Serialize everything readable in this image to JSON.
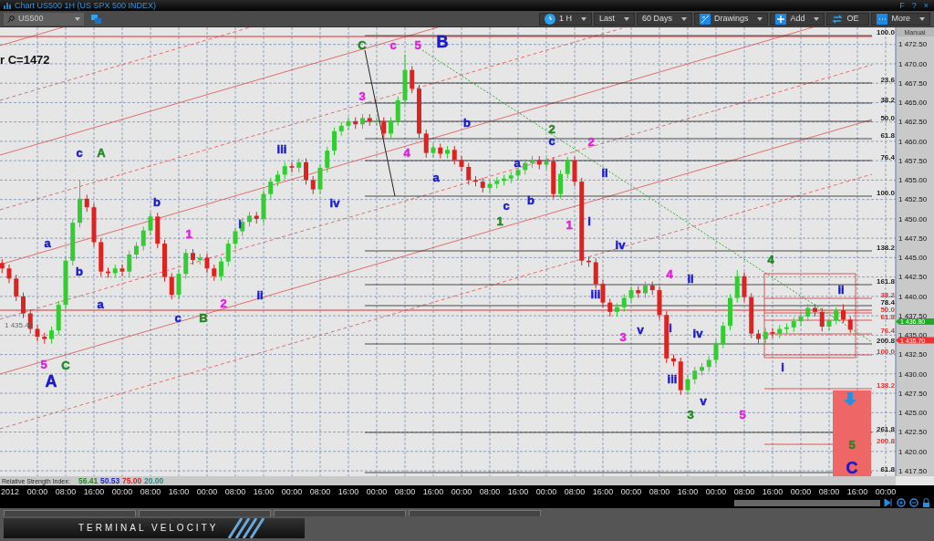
{
  "window": {
    "title": "Chart US500 1H (US SPX 500 INDEX)",
    "controls": [
      "F",
      "?",
      "×"
    ]
  },
  "toolbar": {
    "symbol": "US500",
    "buttons": [
      {
        "label": "1 H",
        "dropdown": true
      },
      {
        "label": "Last",
        "dropdown": true
      },
      {
        "label": "60 Days",
        "dropdown": true
      },
      {
        "label": "Drawings",
        "dropdown": true
      },
      {
        "label": "Add",
        "dropdown": true
      },
      {
        "label": "OE",
        "dropdown": false
      },
      {
        "label": "More",
        "dropdown": true
      }
    ]
  },
  "chart": {
    "annotation": "r C=1472",
    "prior_close": "1 435.40",
    "year_label": "2012",
    "chart_data": {
      "type": "candlestick",
      "ylim": [
        1416.8,
        1474.7
      ],
      "categories": [
        null,
        null,
        null,
        null,
        null,
        "00:00",
        null,
        null,
        null,
        "08:00",
        null,
        null,
        null,
        "16:00",
        null,
        null,
        null,
        "00:00",
        null,
        null,
        null,
        "08:00",
        null,
        null,
        null,
        "16:00",
        null,
        null,
        null,
        "00:00",
        null,
        null,
        null,
        "08:00",
        null,
        null,
        null,
        "16:00",
        null,
        null,
        null,
        "00:00",
        null,
        null,
        null,
        "08:00",
        null,
        null,
        null,
        "16:00",
        null,
        null,
        null,
        "00:00",
        null,
        null,
        null,
        "08:00",
        null,
        null,
        null,
        "16:00",
        null,
        null,
        null,
        "00:00",
        null,
        null,
        null,
        "08:00",
        null,
        null,
        null,
        "16:00",
        null,
        null,
        null,
        "00:00",
        null,
        null,
        null,
        "08:00",
        null,
        null,
        null,
        "16:00",
        null,
        null,
        null,
        "00:00",
        null,
        null,
        null,
        "08:00",
        null,
        null,
        null,
        "16:00",
        null,
        null,
        null,
        "00:00",
        null,
        null,
        null,
        "08:00",
        null,
        null,
        null,
        "16:00",
        null,
        null,
        null,
        "00:00",
        null,
        null,
        null,
        "08:00",
        null,
        null,
        null,
        "16:00",
        null,
        null,
        null,
        "00:00"
      ],
      "yticks": [
        {
          "value": 1472.5,
          "label": "1 472.50"
        },
        {
          "value": 1470,
          "label": "1 470.00"
        },
        {
          "value": 1467.5,
          "label": "1 467.50"
        },
        {
          "value": 1465,
          "label": "1 465.00"
        },
        {
          "value": 1462.5,
          "label": "1 462.50"
        },
        {
          "value": 1460,
          "label": "1 460.00"
        },
        {
          "value": 1457.5,
          "label": "1 457.50"
        },
        {
          "value": 1455,
          "label": "1 455.00"
        },
        {
          "value": 1452.5,
          "label": "1 452.50"
        },
        {
          "value": 1450,
          "label": "1 450.00"
        },
        {
          "value": 1447.5,
          "label": "1 447.50"
        },
        {
          "value": 1445,
          "label": "1 445.00"
        },
        {
          "value": 1442.5,
          "label": "1 442.50"
        },
        {
          "value": 1440,
          "label": "1 440.00"
        },
        {
          "value": 1437.5,
          "label": "1 437.50"
        },
        {
          "value": 1435,
          "label": "1 435.00"
        },
        {
          "value": 1432.5,
          "label": "1 432.50"
        },
        {
          "value": 1430,
          "label": "1 430.00"
        },
        {
          "value": 1427.5,
          "label": "1 427.50"
        },
        {
          "value": 1425,
          "label": "1 425.00"
        },
        {
          "value": 1422.5,
          "label": "1 422.50"
        },
        {
          "value": 1420,
          "label": "1 420.00"
        },
        {
          "value": 1417.5,
          "label": "1 417.50"
        }
      ],
      "ohlc": [
        [
          1444.3,
          1444.8,
          1443.0,
          1443.6
        ],
        [
          1443.6,
          1444.1,
          1441.7,
          1442.3
        ],
        [
          1442.3,
          1442.8,
          1439.4,
          1440.0
        ],
        [
          1440.0,
          1440.5,
          1437.2,
          1437.8
        ],
        [
          1437.8,
          1438.3,
          1435.2,
          1435.8
        ],
        [
          1435.8,
          1436.3,
          1434.2,
          1434.8
        ],
        [
          1434.8,
          1435.3,
          1433.9,
          1434.5
        ],
        [
          1434.5,
          1436.1,
          1433.9,
          1435.6
        ],
        [
          1435.6,
          1439.4,
          1435.0,
          1438.9
        ],
        [
          1438.9,
          1445.1,
          1438.3,
          1444.6
        ],
        [
          1444.6,
          1450.0,
          1444.0,
          1449.5
        ],
        [
          1449.5,
          1455.0,
          1448.9,
          1452.6
        ],
        [
          1452.6,
          1453.1,
          1450.9,
          1451.5
        ],
        [
          1451.5,
          1452.0,
          1446.4,
          1447.0
        ],
        [
          1447.0,
          1447.5,
          1442.6,
          1443.2
        ],
        [
          1443.2,
          1443.7,
          1442.4,
          1443.0
        ],
        [
          1443.0,
          1444.1,
          1442.4,
          1443.6
        ],
        [
          1443.6,
          1444.1,
          1442.6,
          1443.2
        ],
        [
          1443.2,
          1445.9,
          1442.6,
          1445.4
        ],
        [
          1445.4,
          1447.0,
          1444.8,
          1446.5
        ],
        [
          1446.5,
          1449.0,
          1445.9,
          1448.5
        ],
        [
          1448.5,
          1450.8,
          1447.9,
          1450.3
        ],
        [
          1450.3,
          1450.8,
          1446.2,
          1446.8
        ],
        [
          1446.8,
          1447.3,
          1441.9,
          1442.5
        ],
        [
          1442.5,
          1443.0,
          1439.6,
          1440.2
        ],
        [
          1440.2,
          1443.4,
          1439.6,
          1442.9
        ],
        [
          1442.9,
          1446.1,
          1442.3,
          1445.6
        ],
        [
          1445.6,
          1446.1,
          1444.1,
          1444.7
        ],
        [
          1444.7,
          1445.5,
          1444.1,
          1445.0
        ],
        [
          1445.0,
          1445.5,
          1443.0,
          1443.6
        ],
        [
          1443.6,
          1444.1,
          1442.0,
          1442.6
        ],
        [
          1442.6,
          1445.0,
          1442.0,
          1444.5
        ],
        [
          1444.5,
          1447.3,
          1443.9,
          1446.8
        ],
        [
          1446.8,
          1448.9,
          1446.2,
          1448.4
        ],
        [
          1448.4,
          1450.1,
          1447.8,
          1449.6
        ],
        [
          1449.6,
          1450.9,
          1449.0,
          1450.4
        ],
        [
          1450.4,
          1450.9,
          1449.4,
          1450.0
        ],
        [
          1450.0,
          1453.7,
          1449.4,
          1453.2
        ],
        [
          1453.2,
          1455.3,
          1452.6,
          1454.8
        ],
        [
          1454.8,
          1456.2,
          1454.2,
          1455.7
        ],
        [
          1455.7,
          1457.3,
          1455.1,
          1456.8
        ],
        [
          1456.8,
          1457.3,
          1456.0,
          1456.6
        ],
        [
          1456.6,
          1457.8,
          1456.0,
          1457.3
        ],
        [
          1457.3,
          1457.8,
          1454.4,
          1455.0
        ],
        [
          1455.0,
          1455.5,
          1453.2,
          1453.8
        ],
        [
          1453.8,
          1457.1,
          1453.2,
          1456.6
        ],
        [
          1456.6,
          1459.3,
          1456.0,
          1458.8
        ],
        [
          1458.8,
          1461.8,
          1458.2,
          1461.3
        ],
        [
          1461.3,
          1462.5,
          1460.7,
          1462.0
        ],
        [
          1462.0,
          1463.1,
          1461.4,
          1462.6
        ],
        [
          1462.6,
          1463.1,
          1461.6,
          1462.2
        ],
        [
          1462.2,
          1463.5,
          1461.6,
          1463.0
        ],
        [
          1463.0,
          1463.5,
          1462.0,
          1462.6
        ],
        [
          1462.6,
          1463.1,
          1462.0,
          1462.6
        ],
        [
          1462.6,
          1463.1,
          1460.4,
          1461.0
        ],
        [
          1461.0,
          1463.1,
          1460.4,
          1462.6
        ],
        [
          1462.6,
          1465.8,
          1462.0,
          1465.3
        ],
        [
          1465.3,
          1471.2,
          1464.7,
          1469.2
        ],
        [
          1469.2,
          1469.7,
          1466.2,
          1466.8
        ],
        [
          1466.8,
          1467.3,
          1460.4,
          1461.0
        ],
        [
          1461.0,
          1461.5,
          1457.9,
          1458.5
        ],
        [
          1458.5,
          1459.7,
          1457.9,
          1459.2
        ],
        [
          1459.2,
          1459.7,
          1457.8,
          1458.4
        ],
        [
          1458.4,
          1459.4,
          1457.8,
          1458.9
        ],
        [
          1458.9,
          1459.4,
          1457.0,
          1457.6
        ],
        [
          1457.6,
          1458.1,
          1456.1,
          1456.7
        ],
        [
          1456.7,
          1457.2,
          1454.4,
          1455.0
        ],
        [
          1455.0,
          1455.5,
          1454.2,
          1454.8
        ],
        [
          1454.8,
          1455.3,
          1453.4,
          1454.0
        ],
        [
          1454.0,
          1455.0,
          1453.4,
          1454.5
        ],
        [
          1454.5,
          1455.4,
          1453.9,
          1454.9
        ],
        [
          1454.9,
          1455.7,
          1454.3,
          1455.2
        ],
        [
          1455.2,
          1456.1,
          1454.6,
          1455.6
        ],
        [
          1455.6,
          1456.8,
          1455.0,
          1456.3
        ],
        [
          1456.3,
          1457.7,
          1455.7,
          1457.2
        ],
        [
          1457.2,
          1458.1,
          1456.6,
          1457.6
        ],
        [
          1457.6,
          1458.1,
          1456.4,
          1457.0
        ],
        [
          1457.0,
          1457.9,
          1456.4,
          1457.4
        ],
        [
          1457.4,
          1457.9,
          1452.6,
          1453.2
        ],
        [
          1453.2,
          1456.3,
          1452.6,
          1455.8
        ],
        [
          1455.8,
          1458.0,
          1455.2,
          1457.5
        ],
        [
          1457.5,
          1458.0,
          1454.2,
          1454.8
        ],
        [
          1454.8,
          1455.3,
          1444.0,
          1444.6
        ],
        [
          1444.6,
          1445.1,
          1443.8,
          1444.4
        ],
        [
          1444.4,
          1444.9,
          1441.0,
          1441.6
        ],
        [
          1441.6,
          1442.1,
          1438.6,
          1439.2
        ],
        [
          1439.2,
          1439.7,
          1437.4,
          1438.0
        ],
        [
          1438.0,
          1439.1,
          1437.4,
          1438.6
        ],
        [
          1438.6,
          1440.3,
          1438.0,
          1439.8
        ],
        [
          1439.8,
          1441.3,
          1439.2,
          1440.8
        ],
        [
          1440.8,
          1441.3,
          1439.8,
          1440.4
        ],
        [
          1440.4,
          1441.9,
          1439.8,
          1441.4
        ],
        [
          1441.4,
          1441.9,
          1440.2,
          1440.8
        ],
        [
          1440.8,
          1441.3,
          1437.0,
          1437.6
        ],
        [
          1437.6,
          1438.1,
          1431.4,
          1432.0
        ],
        [
          1432.0,
          1432.5,
          1431.0,
          1431.6
        ],
        [
          1431.6,
          1432.1,
          1427.3,
          1427.9
        ],
        [
          1427.9,
          1429.8,
          1427.3,
          1429.3
        ],
        [
          1429.3,
          1430.9,
          1428.7,
          1430.4
        ],
        [
          1430.4,
          1431.4,
          1429.8,
          1430.9
        ],
        [
          1430.9,
          1432.3,
          1430.3,
          1431.8
        ],
        [
          1431.8,
          1434.4,
          1431.2,
          1433.9
        ],
        [
          1433.9,
          1436.7,
          1433.3,
          1436.2
        ],
        [
          1436.2,
          1440.3,
          1435.6,
          1439.8
        ],
        [
          1439.8,
          1443.4,
          1439.2,
          1442.6
        ],
        [
          1442.6,
          1443.1,
          1439.3,
          1439.9
        ],
        [
          1439.9,
          1440.4,
          1434.6,
          1435.2
        ],
        [
          1435.2,
          1435.7,
          1433.9,
          1434.5
        ],
        [
          1434.5,
          1435.9,
          1433.9,
          1435.4
        ],
        [
          1435.4,
          1435.9,
          1434.6,
          1435.2
        ],
        [
          1435.2,
          1436.3,
          1434.6,
          1435.8
        ],
        [
          1435.8,
          1436.5,
          1435.2,
          1436.0
        ],
        [
          1436.0,
          1437.3,
          1435.4,
          1436.8
        ],
        [
          1436.8,
          1437.9,
          1436.2,
          1437.4
        ],
        [
          1437.4,
          1439.0,
          1436.8,
          1438.5
        ],
        [
          1438.5,
          1439.0,
          1437.4,
          1438.0
        ],
        [
          1438.0,
          1438.5,
          1435.5,
          1436.1
        ],
        [
          1436.1,
          1437.2,
          1435.6,
          1436.9
        ],
        [
          1436.9,
          1438.6,
          1436.4,
          1438.2
        ],
        [
          1438.2,
          1439.0,
          1436.6,
          1437.0
        ],
        [
          1437.0,
          1437.4,
          1435.3,
          1435.7
        ],
        null,
        null,
        null,
        null,
        null
      ]
    },
    "wave_labels": [
      {
        "text": "c",
        "color": "#1a1acc",
        "kind": "minor"
      },
      {
        "text": "A",
        "color": "#228822",
        "kind": "minor"
      },
      {
        "text": "a",
        "color": "#1a1acc",
        "kind": "minor"
      },
      {
        "text": "b",
        "color": "#1a1acc",
        "kind": "minor"
      },
      {
        "text": "a",
        "color": "#1a1acc",
        "kind": "minor"
      },
      {
        "text": "5",
        "color": "#dd22dd",
        "kind": "minor"
      },
      {
        "text": "C",
        "color": "#228822",
        "kind": "minor"
      },
      {
        "text": "A",
        "color": "#1a1acc",
        "kind": "major"
      },
      {
        "text": "b",
        "color": "#1a1acc",
        "kind": "minor"
      },
      {
        "text": "c",
        "color": "#1a1acc",
        "kind": "minor"
      },
      {
        "text": "1",
        "color": "#dd22dd",
        "kind": "minor"
      },
      {
        "text": "B",
        "color": "#228822",
        "kind": "minor"
      },
      {
        "text": "2",
        "color": "#dd22dd",
        "kind": "minor"
      },
      {
        "text": "i",
        "color": "#1a1acc",
        "kind": "minor"
      },
      {
        "text": "ii",
        "color": "#1a1acc",
        "kind": "minor"
      },
      {
        "text": "iii",
        "color": "#1a1acc",
        "kind": "minor"
      },
      {
        "text": "iv",
        "color": "#1a1acc",
        "kind": "minor"
      },
      {
        "text": "C",
        "color": "#228822",
        "kind": "minor"
      },
      {
        "text": "c",
        "color": "#dd22dd",
        "kind": "minor"
      },
      {
        "text": "5",
        "color": "#dd22dd",
        "kind": "minor"
      },
      {
        "text": "B",
        "color": "#1a1acc",
        "kind": "major"
      },
      {
        "text": "3",
        "color": "#dd22dd",
        "kind": "minor"
      },
      {
        "text": "4",
        "color": "#dd22dd",
        "kind": "minor"
      },
      {
        "text": "a",
        "color": "#1a1acc",
        "kind": "minor"
      },
      {
        "text": "b",
        "color": "#1a1acc",
        "kind": "minor"
      },
      {
        "text": "2",
        "color": "#228822",
        "kind": "minor"
      },
      {
        "text": "c",
        "color": "#1a1acc",
        "kind": "minor"
      },
      {
        "text": "2",
        "color": "#dd22dd",
        "kind": "minor"
      },
      {
        "text": "ii",
        "color": "#1a1acc",
        "kind": "minor"
      },
      {
        "text": "a",
        "color": "#1a1acc",
        "kind": "minor"
      },
      {
        "text": "c",
        "color": "#1a1acc",
        "kind": "minor"
      },
      {
        "text": "b",
        "color": "#1a1acc",
        "kind": "minor"
      },
      {
        "text": "1",
        "color": "#228822",
        "kind": "minor"
      },
      {
        "text": "1",
        "color": "#dd22dd",
        "kind": "minor"
      },
      {
        "text": "i",
        "color": "#1a1acc",
        "kind": "minor"
      },
      {
        "text": "iv",
        "color": "#1a1acc",
        "kind": "minor"
      },
      {
        "text": "iii",
        "color": "#1a1acc",
        "kind": "minor"
      },
      {
        "text": "3",
        "color": "#dd22dd",
        "kind": "minor"
      },
      {
        "text": "v",
        "color": "#1a1acc",
        "kind": "minor"
      },
      {
        "text": "4",
        "color": "#dd22dd",
        "kind": "minor"
      },
      {
        "text": "ii",
        "color": "#1a1acc",
        "kind": "minor"
      },
      {
        "text": "i",
        "color": "#1a1acc",
        "kind": "minor"
      },
      {
        "text": "iv",
        "color": "#1a1acc",
        "kind": "minor"
      },
      {
        "text": "iii",
        "color": "#1a1acc",
        "kind": "minor"
      },
      {
        "text": "v",
        "color": "#1a1acc",
        "kind": "minor"
      },
      {
        "text": "3",
        "color": "#228822",
        "kind": "minor"
      },
      {
        "text": "5",
        "color": "#dd22dd",
        "kind": "minor"
      },
      {
        "text": "4",
        "color": "#228822",
        "kind": "minor"
      },
      {
        "text": "ii",
        "color": "#1a1acc",
        "kind": "minor"
      },
      {
        "text": "i",
        "color": "#1a1acc",
        "kind": "minor"
      },
      {
        "text": "5",
        "color": "#228822",
        "kind": "minor"
      },
      {
        "text": "C",
        "color": "#1a1acc",
        "kind": "major"
      }
    ],
    "fib_levels": [
      {
        "text": "100.0",
        "color": "#222222"
      },
      {
        "text": "23.6",
        "color": "#222222"
      },
      {
        "text": "38.2",
        "color": "#222222"
      },
      {
        "text": "50.0",
        "color": "#222222"
      },
      {
        "text": "61.8",
        "color": "#222222"
      },
      {
        "text": "76.4",
        "color": "#222222"
      },
      {
        "text": "100.0",
        "color": "#222222"
      },
      {
        "text": "138.2",
        "color": "#222222"
      },
      {
        "text": "161.8",
        "color": "#222222"
      },
      {
        "text": "38.2",
        "color": "#dd3333"
      },
      {
        "text": "78.4",
        "color": "#222222"
      },
      {
        "text": "50.0",
        "color": "#dd3333"
      },
      {
        "text": "61.8",
        "color": "#dd3333"
      },
      {
        "text": "76.4",
        "color": "#dd3333"
      },
      {
        "text": "200.8",
        "color": "#222222"
      },
      {
        "text": "100.0",
        "color": "#dd3333"
      },
      {
        "text": "138.2",
        "color": "#dd3333"
      },
      {
        "text": "261.8",
        "color": "#222222"
      },
      {
        "text": "200.8",
        "color": "#dd3333"
      },
      {
        "text": "61.8",
        "color": "#222222"
      }
    ],
    "price_axis": {
      "mode": "Manual"
    },
    "price_tags": [
      {
        "text": "1 436.80",
        "color": "#22aa22"
      },
      {
        "text": "1 435.70",
        "color": "#ee3333"
      }
    ]
  },
  "indicator": {
    "name": "Relative Strength Index:",
    "values": [
      {
        "text": "56.41",
        "color": "#228822"
      },
      {
        "text": "50.53",
        "color": "#2222cc"
      },
      {
        "text": "75.00",
        "color": "#cc2222"
      },
      {
        "text": "20.00",
        "color": "#228888"
      }
    ]
  },
  "footer": {
    "brand": "TERMINAL VELOCITY"
  }
}
